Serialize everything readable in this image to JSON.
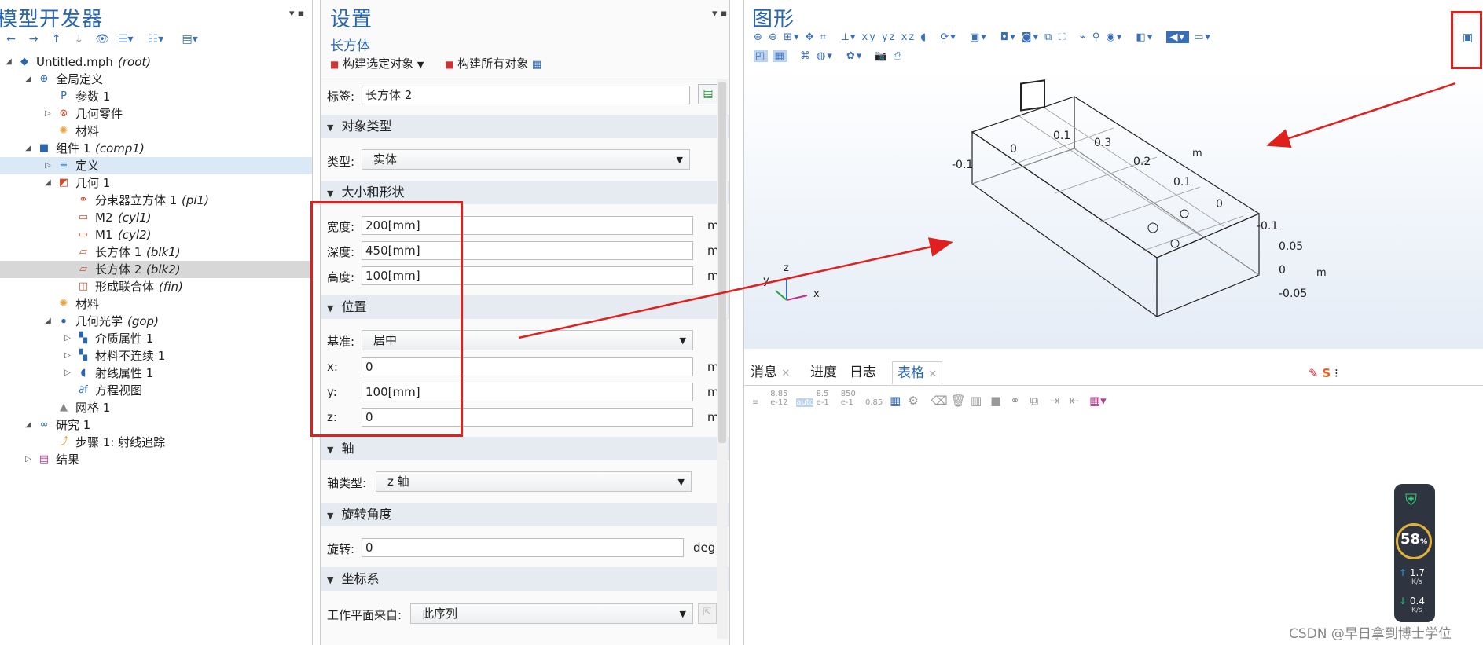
{
  "left_panel": {
    "title": "模型开发器",
    "tree": [
      {
        "label": "Untitled.mph",
        "tag": "(root)",
        "icon": "mph-file-icon",
        "level": 0,
        "toggle": "open"
      },
      {
        "label": "全局定义",
        "tag": "",
        "icon": "globe-icon",
        "level": 1,
        "toggle": "open"
      },
      {
        "label": "参数 1",
        "tag": "",
        "icon": "parameters-icon",
        "level": 2,
        "toggle": ""
      },
      {
        "label": "几何零件",
        "tag": "",
        "icon": "geometry-parts-icon",
        "level": 2,
        "toggle": "closed"
      },
      {
        "label": "材料",
        "tag": "",
        "icon": "materials-icon",
        "level": 2,
        "toggle": ""
      },
      {
        "label": "组件 1",
        "tag": "(comp1)",
        "icon": "component-icon",
        "level": 1,
        "toggle": "open"
      },
      {
        "label": "定义",
        "tag": "",
        "icon": "definitions-icon",
        "level": 2,
        "toggle": "closed",
        "selected": "blue"
      },
      {
        "label": "几何 1",
        "tag": "",
        "icon": "geometry-icon",
        "level": 2,
        "toggle": "open"
      },
      {
        "label": "分束器立方体 1",
        "tag": "(pi1)",
        "icon": "part-instance-icon",
        "level": 3,
        "toggle": ""
      },
      {
        "label": "M2",
        "tag": "(cyl1)",
        "icon": "cylinder-icon",
        "level": 3,
        "toggle": ""
      },
      {
        "label": "M1",
        "tag": "(cyl2)",
        "icon": "cylinder-icon",
        "level": 3,
        "toggle": ""
      },
      {
        "label": "长方体 1",
        "tag": "(blk1)",
        "icon": "block-icon",
        "level": 3,
        "toggle": ""
      },
      {
        "label": "长方体 2",
        "tag": "(blk2)",
        "icon": "block-icon",
        "level": 3,
        "toggle": "",
        "selected": "grey"
      },
      {
        "label": "形成联合体",
        "tag": "(fin)",
        "icon": "form-union-icon",
        "level": 3,
        "toggle": ""
      },
      {
        "label": "材料",
        "tag": "",
        "icon": "materials-icon",
        "level": 2,
        "toggle": ""
      },
      {
        "label": "几何光学",
        "tag": "(gop)",
        "icon": "geometrical-optics-icon",
        "level": 2,
        "toggle": "open"
      },
      {
        "label": "介质属性 1",
        "tag": "",
        "icon": "medium-properties-icon",
        "level": 3,
        "toggle": "closed"
      },
      {
        "label": "材料不连续 1",
        "tag": "",
        "icon": "material-discontinuity-icon",
        "level": 3,
        "toggle": "closed"
      },
      {
        "label": "射线属性 1",
        "tag": "",
        "icon": "ray-properties-icon",
        "level": 3,
        "toggle": "closed"
      },
      {
        "label": "方程视图",
        "tag": "",
        "icon": "equation-view-icon",
        "level": 3,
        "toggle": ""
      },
      {
        "label": "网格 1",
        "tag": "",
        "icon": "mesh-icon",
        "level": 2,
        "toggle": ""
      },
      {
        "label": "研究 1",
        "tag": "",
        "icon": "study-icon",
        "level": 1,
        "toggle": "open"
      },
      {
        "label": "步骤 1: 射线追踪",
        "tag": "",
        "icon": "ray-tracing-step-icon",
        "level": 2,
        "toggle": ""
      },
      {
        "label": "结果",
        "tag": "",
        "icon": "results-icon",
        "level": 1,
        "toggle": "closed"
      }
    ]
  },
  "settings": {
    "title": "设置",
    "subtitle": "长方体",
    "build_selected": "构建选定对象",
    "build_all": "构建所有对象",
    "label_caption": "标签:",
    "label_value": "长方体 2",
    "object_type_section": "对象类型",
    "type_caption": "类型:",
    "type_value": "实体",
    "size_section": "大小和形状",
    "width_caption": "宽度:",
    "width_value": "200[mm]",
    "depth_caption": "深度:",
    "depth_value": "450[mm]",
    "height_caption": "高度:",
    "height_value": "100[mm]",
    "unit_m": "m",
    "position_section": "位置",
    "base_caption": "基准:",
    "base_value": "居中",
    "x_caption": "x:",
    "x_value": "0",
    "y_caption": "y:",
    "y_value": "100[mm]",
    "z_caption": "z:",
    "z_value": "0",
    "axis_section": "轴",
    "axis_type_caption": "轴类型:",
    "axis_type_value": "z 轴",
    "rotation_section": "旋转角度",
    "rotation_caption": "旋转:",
    "rotation_value": "0",
    "rotation_unit": "deg",
    "coord_section": "坐标系",
    "workplane_caption": "工作平面来自:",
    "workplane_value": "此序列"
  },
  "graphics": {
    "title": "图形",
    "axis_ticks_top": [
      "-0.1",
      "0",
      "0.1",
      "0.3",
      "0.2",
      "0.1",
      "0",
      "-0.1"
    ],
    "axis_ticks_right": [
      "0.05",
      "0",
      "-0.05"
    ],
    "axis_unit": "m",
    "triad": {
      "x": "x",
      "y": "y",
      "z": "z"
    }
  },
  "bottom_tabs": {
    "messages": "消息",
    "progress": "进度",
    "log": "日志",
    "table": "表格",
    "numbers": [
      "8.85\ne-12",
      "8.5\ne-1",
      "850\ne-1",
      "0.85"
    ]
  },
  "widget": {
    "percent": "58",
    "percent_sign": "%",
    "up": "1.7",
    "up_unit": "K/s",
    "down": "0.4",
    "down_unit": "K/s"
  },
  "watermark": "CSDN @早日拿到博士学位",
  "colors": {
    "accent": "#2a67b1",
    "annotation_red": "#e0201e",
    "section_bg": "#e6ebf1"
  }
}
